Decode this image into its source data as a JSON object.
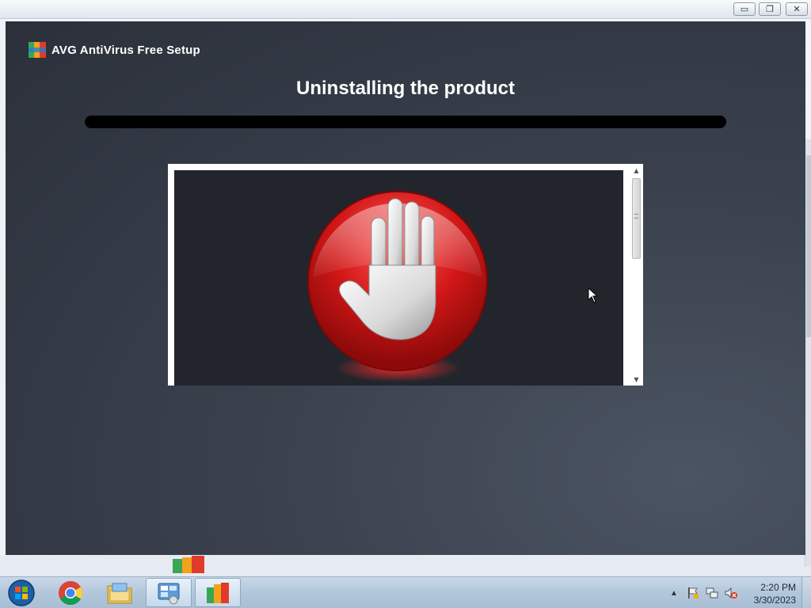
{
  "window_controls": {
    "minimize": "▭",
    "restore": "❐",
    "close": "✕"
  },
  "installer": {
    "app_title": "AVG AntiVirus Free Setup",
    "status_title": "Uninstalling the product",
    "progress": 0,
    "colors": {
      "background": "#2b303a",
      "progress_track": "#000000",
      "progress_fill": "#64b33f"
    },
    "promo": {
      "icon": "stop-hand-icon"
    }
  },
  "taskbar": {
    "start_icon": "windows-start-icon",
    "apps": [
      {
        "name": "chrome",
        "icon": "chrome-icon"
      },
      {
        "name": "explorer",
        "icon": "folder-icon"
      },
      {
        "name": "control-panel",
        "icon": "control-panel-icon"
      },
      {
        "name": "avg-setup",
        "icon": "avg-icon",
        "active": true
      }
    ],
    "tray": {
      "show_hidden": "▲",
      "icons": [
        "action-center-flag-icon",
        "network-icon",
        "volume-muted-icon"
      ]
    },
    "clock": {
      "time": "2:20 PM",
      "date": "3/30/2023"
    }
  }
}
